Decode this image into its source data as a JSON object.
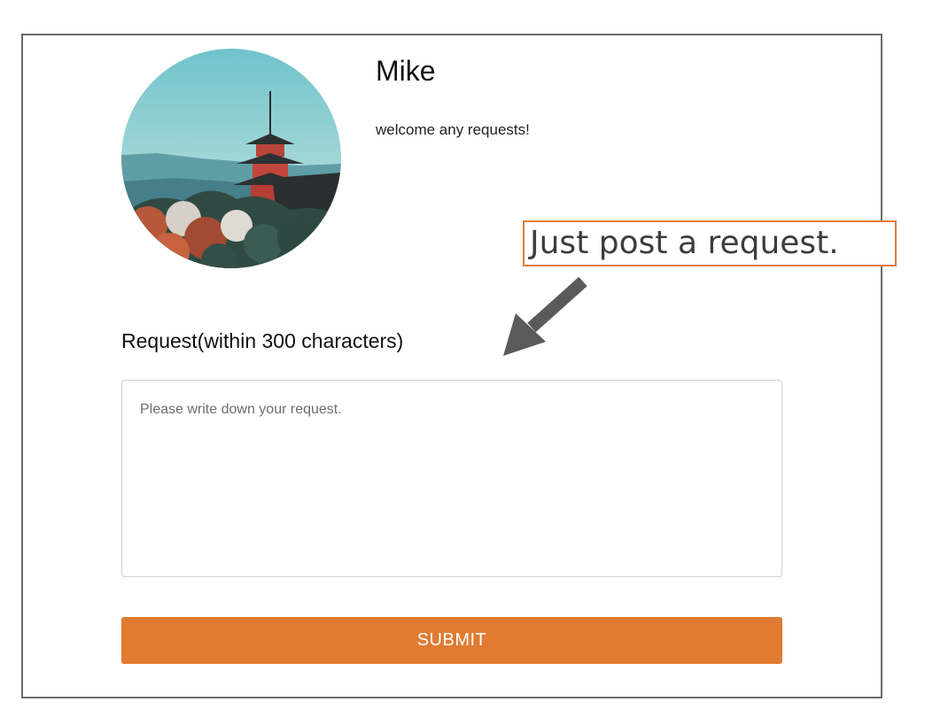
{
  "profile": {
    "name": "Mike",
    "bio": "welcome any requests!",
    "avatar_icon": "pagoda-landscape-photo"
  },
  "callout": {
    "text": "Just post a request.",
    "border_color": "#e07b39",
    "arrow_icon": "arrow-down-left-icon"
  },
  "form": {
    "label": "Request(within 300 characters)",
    "placeholder": "Please write down your request.",
    "value": "",
    "submit_label": "SUBMIT",
    "accent_color": "#e07b31"
  }
}
